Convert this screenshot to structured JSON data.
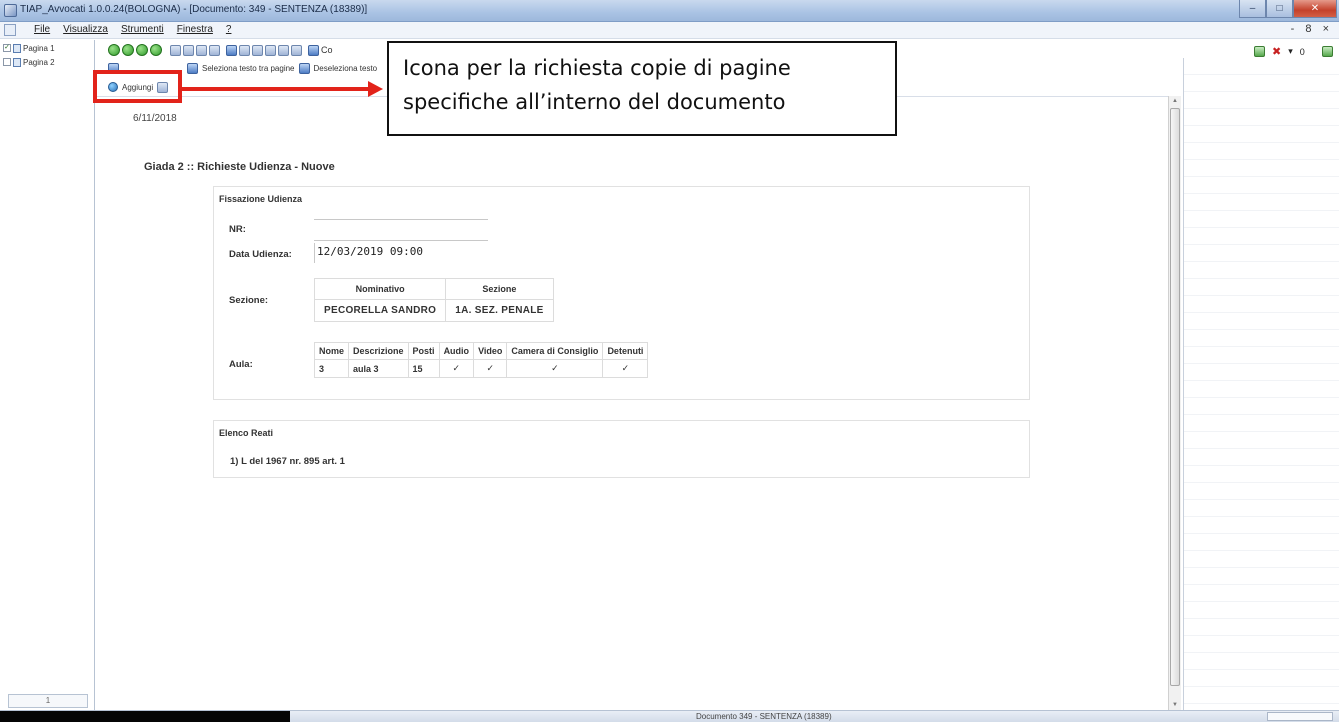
{
  "window": {
    "title": "TIAP_Avvocati 1.0.0.24(BOLOGNA) - [Documento: 349 - SENTENZA (18389)]",
    "minimize": "–",
    "maximize": "□",
    "close": "✕"
  },
  "menu": {
    "items": [
      "File",
      "Visualizza",
      "Strumenti",
      "Finestra",
      "?"
    ],
    "mdi_controls": "- 8 ×"
  },
  "pages": {
    "items": [
      {
        "label": "Pagina 1",
        "checked": true
      },
      {
        "label": "Pagina 2",
        "checked": false
      }
    ],
    "page_number": "1"
  },
  "toolbar": {
    "text_button": "Co",
    "select_text": "Seleziona testo tra pagine",
    "deselect_text": "Deseleziona testo",
    "add_label": "Aggiungi",
    "right_count": "0"
  },
  "document": {
    "date": "6/11/2018",
    "heading": "Giada 2 :: Richieste Udienza - Nuove",
    "fissazione": {
      "title": "Fissazione Udienza",
      "nr_label": "NR:",
      "nr_value": "",
      "data_label": "Data Udienza:",
      "data_value": "12/03/2019 09:00",
      "sezione_label": "Sezione:",
      "sezione_headers": [
        "Nominativo",
        "Sezione"
      ],
      "sezione_row": [
        "PECORELLA SANDRO",
        "1A. SEZ. PENALE"
      ],
      "aula_label": "Aula:",
      "aula_headers": [
        "Nome",
        "Descrizione",
        "Posti",
        "Audio",
        "Video",
        "Camera di Consiglio",
        "Detenuti"
      ],
      "aula_row": [
        "3",
        "aula 3",
        "15",
        "✓",
        "✓",
        "✓",
        "✓"
      ]
    },
    "reati": {
      "title": "Elenco Reati",
      "items": [
        "1) L del 1967 nr. 895 art. 1"
      ]
    }
  },
  "annotation": {
    "line1": "Icona per la richiesta copie di pagine",
    "line2": "specifiche all’interno del documento",
    "color": "#e2231a"
  },
  "status": {
    "text": "Documento 349 - SENTENZA (18389)"
  }
}
